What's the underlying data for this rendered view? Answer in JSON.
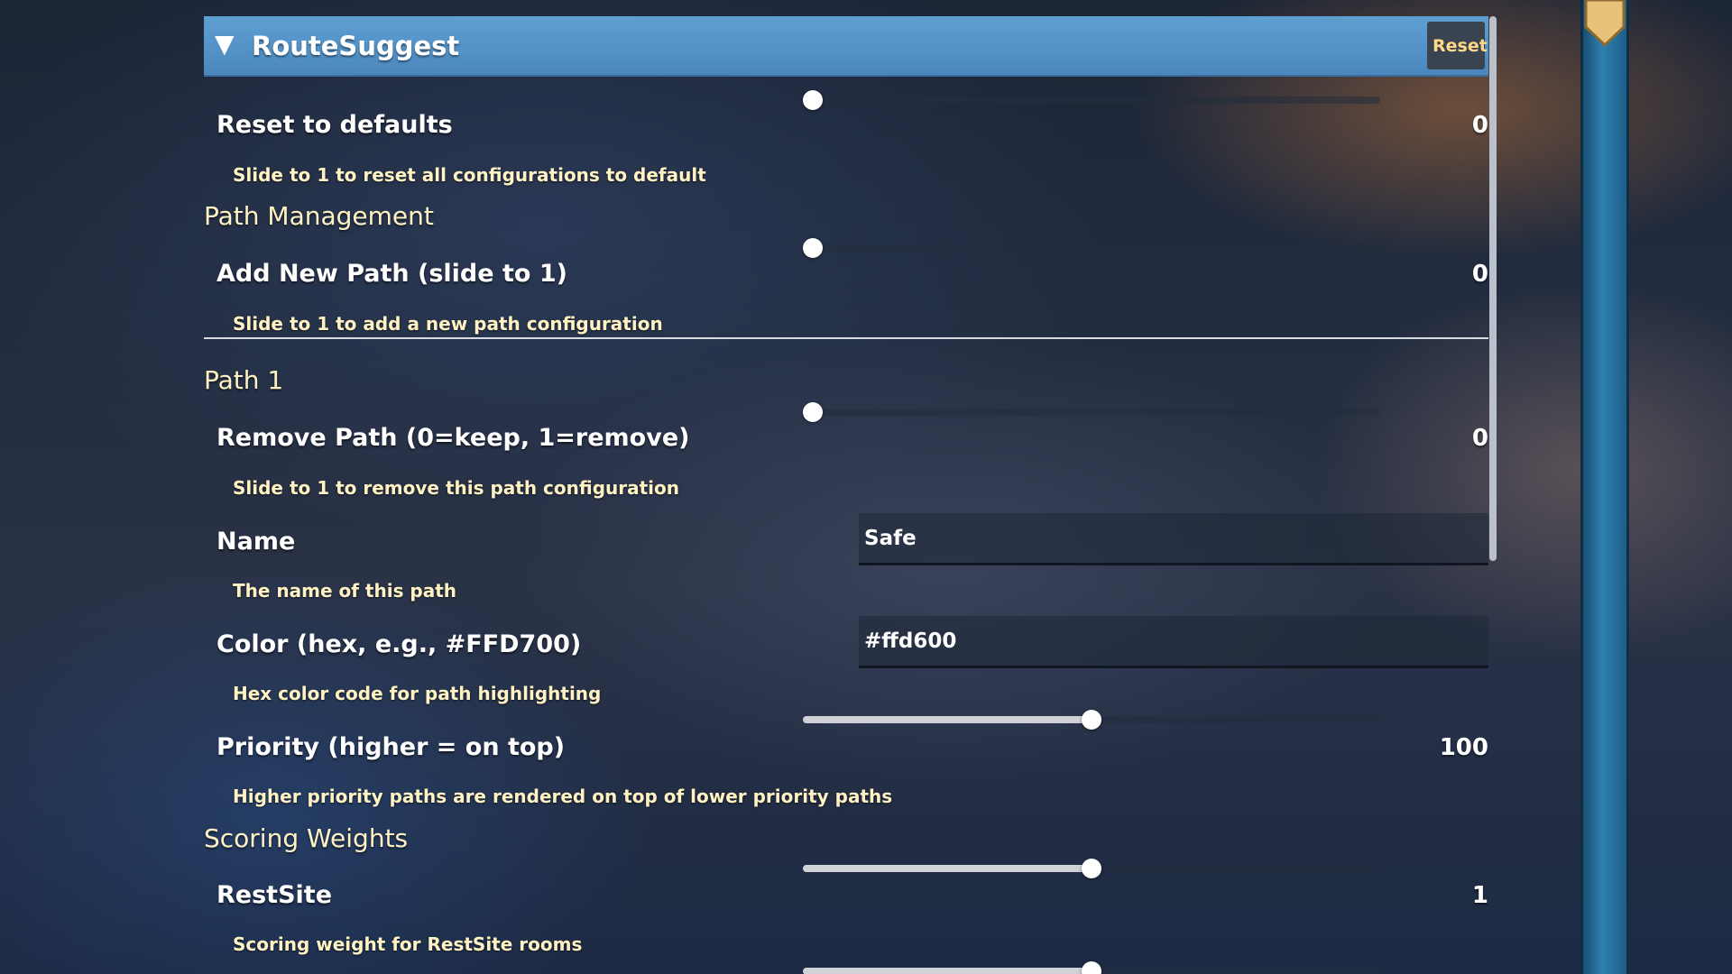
{
  "header": {
    "title": "RouteSuggest",
    "reset_label": "Reset",
    "collapse_icon": "triangle-down-icon"
  },
  "settings": {
    "reset_defaults": {
      "label": "Reset to defaults",
      "description": "Slide to 1 to reset all configurations to default",
      "value": "0",
      "level": 0
    },
    "path_management": {
      "heading": "Path Management"
    },
    "add_new_path": {
      "label": "Add New Path (slide to 1)",
      "description": "Slide to 1 to add a new path configuration",
      "value": "0",
      "level": 0
    },
    "path1": {
      "heading": "Path 1",
      "remove_path": {
        "label": "Remove Path (0=keep, 1=remove)",
        "description": "Slide to 1 to remove this path configuration",
        "value": "0",
        "level": 0
      },
      "name": {
        "label": "Name",
        "description": "The name of this path",
        "value": "Safe"
      },
      "color": {
        "label": "Color (hex, e.g., #FFD700)",
        "description": "Hex color code for path highlighting",
        "value": "#ffd600"
      },
      "priority": {
        "label": "Priority (higher = on top)",
        "description": "Higher priority paths are rendered on top of lower priority paths",
        "value": "100",
        "level": 0.5
      }
    },
    "scoring_weights": {
      "heading": "Scoring Weights",
      "restsite": {
        "label": "RestSite",
        "description": "Scoring weight for RestSite rooms",
        "value": "1",
        "level": 0.5
      },
      "next_slider_level": 0.5
    }
  },
  "colors": {
    "header": "#5e9fd2",
    "accent_text": "#fff3c4",
    "reset_text": "#ffd88a",
    "side_strip": "#2d7fb0"
  }
}
